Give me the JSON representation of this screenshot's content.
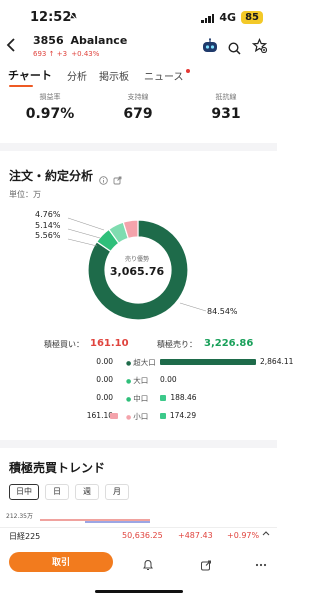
{
  "status_bar": {
    "time": "12:52",
    "network": "4G",
    "battery": "85"
  },
  "header": {
    "code": "3856",
    "name": "Abalance",
    "price": "693",
    "change": "+3",
    "change_pct": "+0.43%"
  },
  "tabs": [
    {
      "label": "チャート"
    },
    {
      "label": "分析"
    },
    {
      "label": "掲示板"
    },
    {
      "label": "ニュース"
    }
  ],
  "metrics": [
    {
      "label": "損益率",
      "value": "0.97%"
    },
    {
      "label": "支持線",
      "value": "679"
    },
    {
      "label": "抵抗線",
      "value": "931"
    }
  ],
  "order_analysis": {
    "title": "注文・約定分析",
    "unit": "単位：万",
    "center_label": "売り優勢",
    "center_value": "3,065.76",
    "chart_data": {
      "type": "pie",
      "slices": [
        {
          "label": "84.54%",
          "value": 84.54,
          "color": "#1e6b4a"
        },
        {
          "label": "5.56%",
          "value": 5.56,
          "color": "#2fbf7a"
        },
        {
          "label": "5.14%",
          "value": 5.14,
          "color": "#7fdcb0"
        },
        {
          "label": "4.76%",
          "value": 4.76,
          "color": "#f4a3ab"
        }
      ]
    },
    "active_buy_label": "積極買い：",
    "active_buy_value": "161.10",
    "active_sell_label": "積極売り：",
    "active_sell_value": "3,226.86",
    "rows": [
      {
        "left": "0.00",
        "category": "超大口",
        "right": "2,864.11",
        "right_frac": 1.0,
        "left_frac": 0
      },
      {
        "left": "0.00",
        "category": "大口",
        "right": "0.00",
        "right_frac": 0,
        "left_frac": 0
      },
      {
        "left": "0.00",
        "category": "中口",
        "right": "188.46",
        "right_frac": 0.066,
        "left_frac": 0
      },
      {
        "left": "161.10",
        "category": "小口",
        "right": "174.29",
        "right_frac": 0.061,
        "left_frac": 1.0
      }
    ]
  },
  "trend": {
    "title": "積極売買トレンド",
    "periods": [
      {
        "label": "日中"
      },
      {
        "label": "日"
      },
      {
        "label": "週"
      },
      {
        "label": "月"
      }
    ],
    "axis_label": "212.35万"
  },
  "ticker": {
    "name": "日経225",
    "value": "50,636.25",
    "change": "+487.43",
    "pct": "+0.97%"
  },
  "bottom": {
    "trade_label": "取引"
  },
  "colors": {
    "up": "#e0443e",
    "down": "#1e6b4a",
    "accent": "#f27b1e"
  }
}
